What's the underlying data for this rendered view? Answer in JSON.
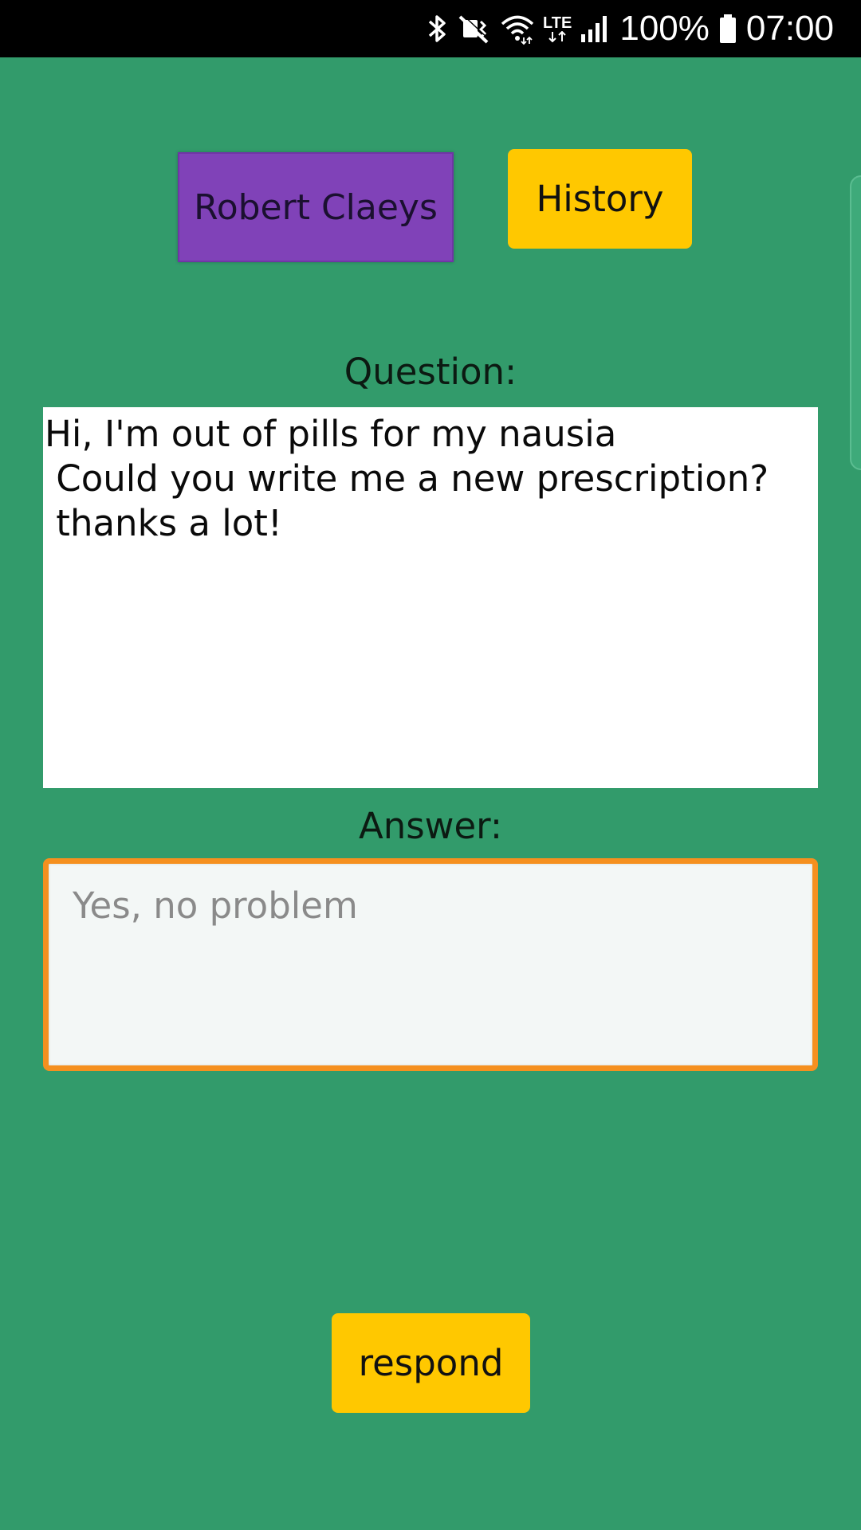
{
  "status_bar": {
    "icons": [
      "bluetooth-icon",
      "vibrate-mute-icon",
      "wifi-icon",
      "lte-icon",
      "signal-icon",
      "battery-icon"
    ],
    "lte_label": "LTE",
    "battery_text": "100%",
    "time": "07:00"
  },
  "header": {
    "patient_name": "Robert Claeys",
    "history_label": "History"
  },
  "question": {
    "label": "Question:",
    "lines": [
      "Hi, I'm out of pills for my nausia",
      " Could you write me a new prescription?",
      " thanks a lot!"
    ]
  },
  "answer": {
    "label": "Answer:",
    "placeholder": "Yes, no problem",
    "value": ""
  },
  "actions": {
    "respond_label": "respond"
  },
  "colors": {
    "background": "#329b6b",
    "patient_button": "#8042b8",
    "history_button": "#ffc800",
    "respond_button": "#ffc800",
    "answer_focus_border": "#f5901f"
  }
}
